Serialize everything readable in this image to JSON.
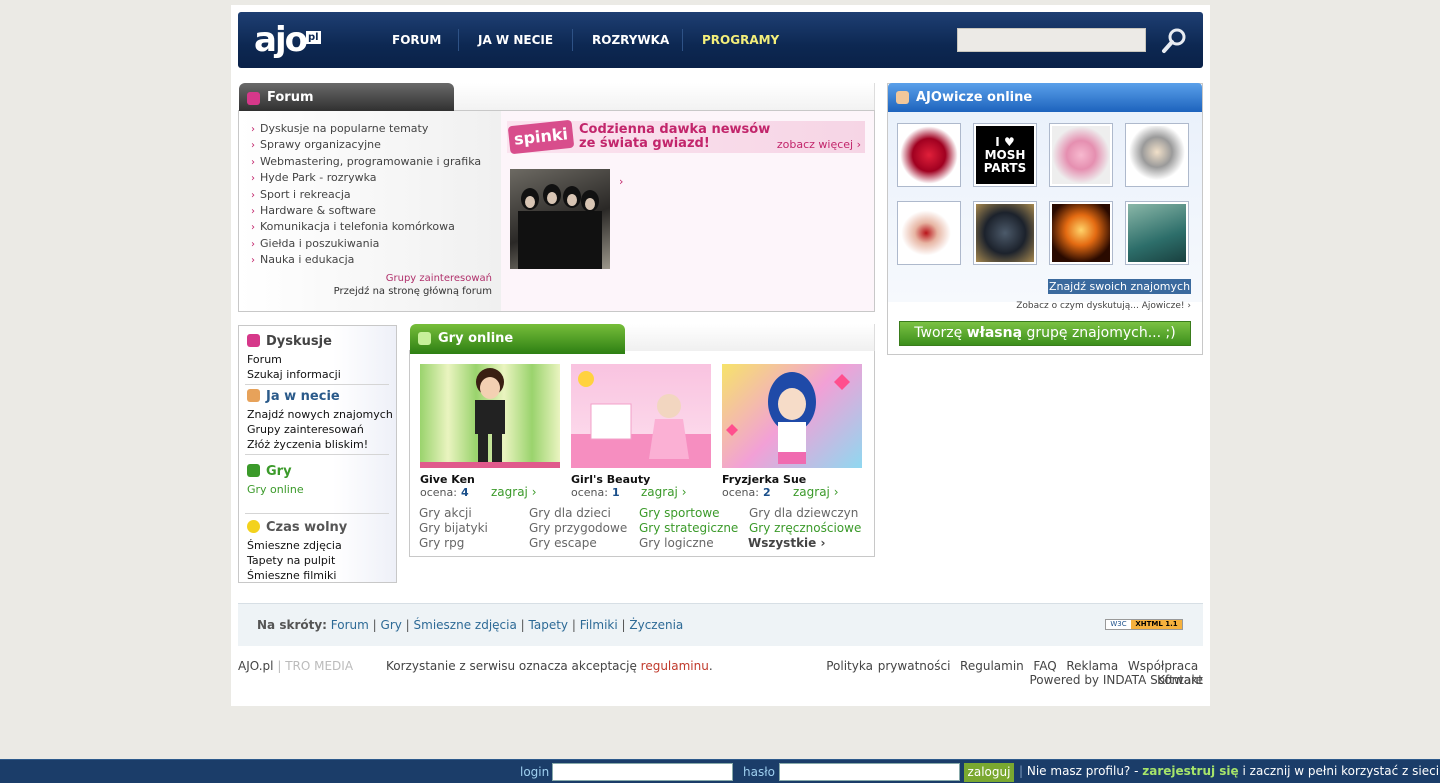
{
  "header": {
    "logo_text": "ajo",
    "logo_pl": "pl",
    "nav": [
      {
        "label": "FORUM"
      },
      {
        "label": "JA W NECIE"
      },
      {
        "label": "ROZRYWKA"
      },
      {
        "label": "PROGRAMY"
      }
    ],
    "search_placeholder": ""
  },
  "forum": {
    "title": "Forum",
    "items": [
      "Dyskusje na popularne tematy",
      "Sprawy organizacyjne",
      "Webmastering, programowanie i grafika",
      "Hyde Park - rozrywka",
      "Sport i rekreacja",
      "Hardware & software",
      "Komunikacja i telefonia komórkowa",
      "Giełda i poszukiwania",
      "Nauka i edukacja"
    ],
    "link_groups": "Grupy zainteresowań",
    "link_main": "Przejdź na stronę główną forum"
  },
  "spinki": {
    "logo": "spinki",
    "headline_1": "Codzienna dawka newsów",
    "headline_2": "ze świata gwiazd!",
    "more": "zobacz więcej",
    "arrow": "›"
  },
  "online": {
    "title": "AJOwicze online",
    "thumb_text": "I ♥ MOSH PARTS",
    "find_btn": "Znajdź swoich znajomych",
    "see_link": "Zobacz o czym dyskutują... Ajowicze!",
    "group_btn_pre": "Tworzę ",
    "group_btn_bold": "własną",
    "group_btn_post": " grupę znajomych... ;)"
  },
  "sidebar": {
    "h_dyskusje": "Dyskusje",
    "forum": "Forum",
    "szukaj": "Szukaj informacji",
    "h_jawnecie": "Ja w necie",
    "znajdz": "Znajdź nowych znajomych",
    "grupy": "Grupy zainteresowań",
    "zyczenia": "Złóż życzenia bliskim!",
    "h_gry": "Gry",
    "gry_online": "Gry online",
    "h_czas": "Czas wolny",
    "smieszne": "Śmieszne zdjęcia",
    "tapety": "Tapety na pulpit",
    "filmiki": "Śmieszne filmiki"
  },
  "games": {
    "title": "Gry online",
    "rating_label": "ocena:",
    "play": "zagraj",
    "list": [
      {
        "title": "Give Ken",
        "rating": "4"
      },
      {
        "title": "Girl's Beauty",
        "rating": "1"
      },
      {
        "title": "Fryzjerka Sue",
        "rating": "2"
      }
    ],
    "categories": [
      "Gry akcji",
      "Gry dla dzieci",
      "Gry sportowe",
      "Gry dla dziewczyn",
      "Gry bijatyki",
      "Gry przygodowe",
      "Gry strategiczne",
      "Gry zręcznościowe",
      "Gry rpg",
      "Gry escape",
      "Gry logiczne",
      "Wszystkie"
    ]
  },
  "shortcuts": {
    "label": "Na skróty:",
    "links": [
      "Forum",
      "Gry",
      "Śmieszne zdjęcia",
      "Tapety",
      "Filmiki",
      "Życzenia"
    ],
    "badge_w3c": "W3C",
    "badge_xhtml": "XHTML 1.1"
  },
  "footer": {
    "brand": "AJO.pl",
    "sep": "|",
    "tro": "TRO MEDIA",
    "terms_pre": "Korzystanie z serwisu oznacza akceptację ",
    "terms_link": "regulaminu",
    "terms_dot": ".",
    "links": [
      "Polityka prywatności",
      "Regulamin",
      "FAQ",
      "Reklama",
      "Współpraca",
      "Kontakt"
    ],
    "powered": "Powered by INDATA Software"
  },
  "loginbar": {
    "login_label": "login",
    "pass_label": "hasło",
    "submit": "zaloguj",
    "cta_pre": "Nie masz profilu? -",
    "cta_link": "zarejestruj się",
    "cta_post": "i zacznij w pełni korzystać z sieci!"
  },
  "colors": {
    "header_blue": "#0d2852",
    "forum_pink": "#c2256b",
    "games_green": "#3b9a2a",
    "online_blue": "#2f7bd4",
    "bottom_bar": "#1b3d69"
  }
}
